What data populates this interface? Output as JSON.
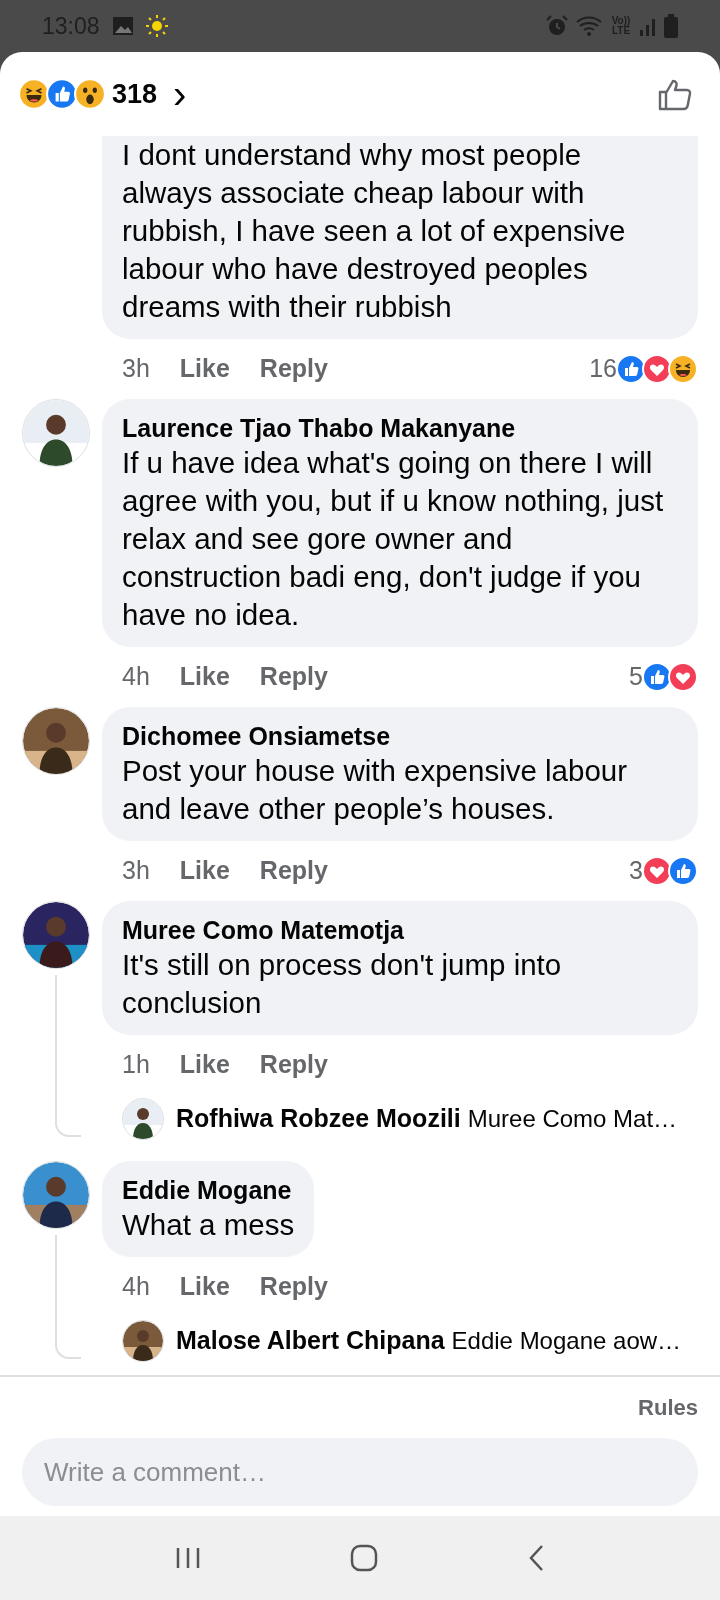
{
  "status_bar": {
    "time": "13:08",
    "network_label": "Vo)) LTE"
  },
  "header": {
    "reactions": [
      {
        "kind": "haha"
      },
      {
        "kind": "like"
      },
      {
        "kind": "wow"
      }
    ],
    "reaction_count": "318",
    "chevron": "›"
  },
  "comments": [
    {
      "text": "I dont understand why most people always associate cheap labour with rubbish, I have seen a lot of expensive labour who have destroyed peoples dreams with their rubbish",
      "time": "3h",
      "like": "Like",
      "reply": "Reply",
      "reaction_count": "16",
      "reactions": [
        {
          "kind": "like"
        },
        {
          "kind": "love"
        },
        {
          "kind": "haha"
        }
      ]
    },
    {
      "name": "Laurence Tjao Thabo Makanyane",
      "text": "If u have idea what's going on there I will agree with you, but if u know nothing, just relax and see gore owner and construction badi eng, don't judge if you have no idea.",
      "time": "4h",
      "like": "Like",
      "reply": "Reply",
      "reaction_count": "5",
      "reactions": [
        {
          "kind": "like"
        },
        {
          "kind": "love"
        }
      ]
    },
    {
      "name": "Dichomee Onsiametse",
      "text": "Post your house with expensive labour and leave other people’s houses.",
      "time": "3h",
      "like": "Like",
      "reply": "Reply",
      "reaction_count": "3",
      "reactions": [
        {
          "kind": "love"
        },
        {
          "kind": "like"
        }
      ]
    },
    {
      "name": "Muree Como Matemotja",
      "text": "It's still on process don't jump into conclusion",
      "time": "1h",
      "like": "Like",
      "reply": "Reply",
      "replies": [
        {
          "name": "Rofhiwa Robzee Moozili",
          "text": "Muree Como Mat…"
        }
      ]
    },
    {
      "name": "Eddie Mogane",
      "text": "What a mess",
      "time": "4h",
      "like": "Like",
      "reply": "Reply",
      "replies": [
        {
          "name": "Malose Albert Chipana",
          "text": "Eddie Mogane aow…"
        }
      ]
    }
  ],
  "footer": {
    "rules": "Rules",
    "comment_field": {
      "placeholder": "Write a comment…"
    }
  }
}
